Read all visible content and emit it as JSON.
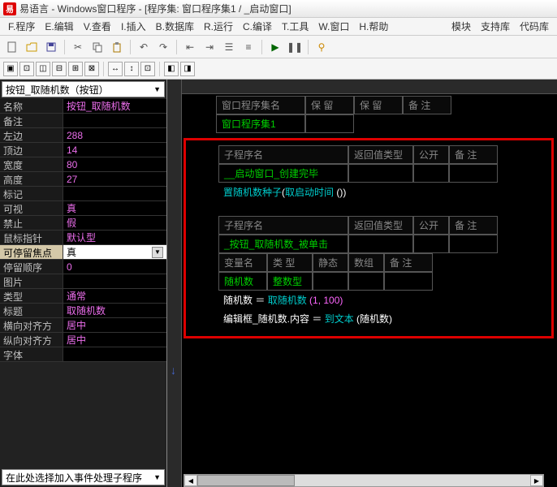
{
  "title": "易语言 - Windows窗口程序 - [程序集: 窗口程序集1 / _启动窗口]",
  "app_icon_text": "易",
  "menu": {
    "items": [
      "F.程序",
      "E.编辑",
      "V.查看",
      "I.插入",
      "B.数据库",
      "R.运行",
      "C.编译",
      "T.工具",
      "W.窗口",
      "H.帮助"
    ],
    "right": [
      "模块",
      "支持库",
      "代码库"
    ]
  },
  "dropdown_top": "按钮_取随机数（按钮）",
  "props": [
    {
      "label": "名称",
      "value": "按钮_取随机数"
    },
    {
      "label": "备注",
      "value": ""
    },
    {
      "label": "左边",
      "value": "288"
    },
    {
      "label": "顶边",
      "value": "14"
    },
    {
      "label": "宽度",
      "value": "80"
    },
    {
      "label": "高度",
      "value": "27"
    },
    {
      "label": "标记",
      "value": ""
    },
    {
      "label": "可视",
      "value": "真"
    },
    {
      "label": "禁止",
      "value": "假"
    },
    {
      "label": "鼠标指针",
      "value": "默认型"
    },
    {
      "label": "可停留焦点",
      "value": "真",
      "selected": true
    },
    {
      "label": "   停留顺序",
      "value": "0"
    },
    {
      "label": "图片",
      "value": ""
    },
    {
      "label": "类型",
      "value": "通常"
    },
    {
      "label": "标题",
      "value": "取随机数"
    },
    {
      "label": "横向对齐方式",
      "value": "居中"
    },
    {
      "label": "纵向对齐方式",
      "value": "居中"
    },
    {
      "label": "字体",
      "value": ""
    }
  ],
  "dropdown_bottom": "在此处选择加入事件处理子程序",
  "code": {
    "header1": {
      "cols": [
        "窗口程序集名",
        "保 留",
        "保 留",
        "备 注"
      ],
      "value": "窗口程序集1"
    },
    "sub1": {
      "cols": [
        "子程序名",
        "返回值类型",
        "公开",
        "备  注"
      ],
      "value": "__启动窗口_创建完毕"
    },
    "line1": {
      "a": "置随机数种子",
      "b": "(",
      "c": "取启动时间",
      "d": " ())"
    },
    "sub2": {
      "cols": [
        "子程序名",
        "返回值类型",
        "公开",
        "备  注"
      ],
      "value": "_按钮_取随机数_被单击"
    },
    "vars": {
      "cols": [
        "变量名",
        "类  型",
        "静态",
        "数组",
        "备  注"
      ],
      "name": "随机数",
      "type": "整数型"
    },
    "line2": {
      "a": "随机数 ＝",
      "b": "取随机数",
      "c": "(1, 100)"
    },
    "line3": {
      "a": "编辑框_随机数.内容 ＝",
      "b": "到文本",
      "c": "(随机数)"
    }
  }
}
